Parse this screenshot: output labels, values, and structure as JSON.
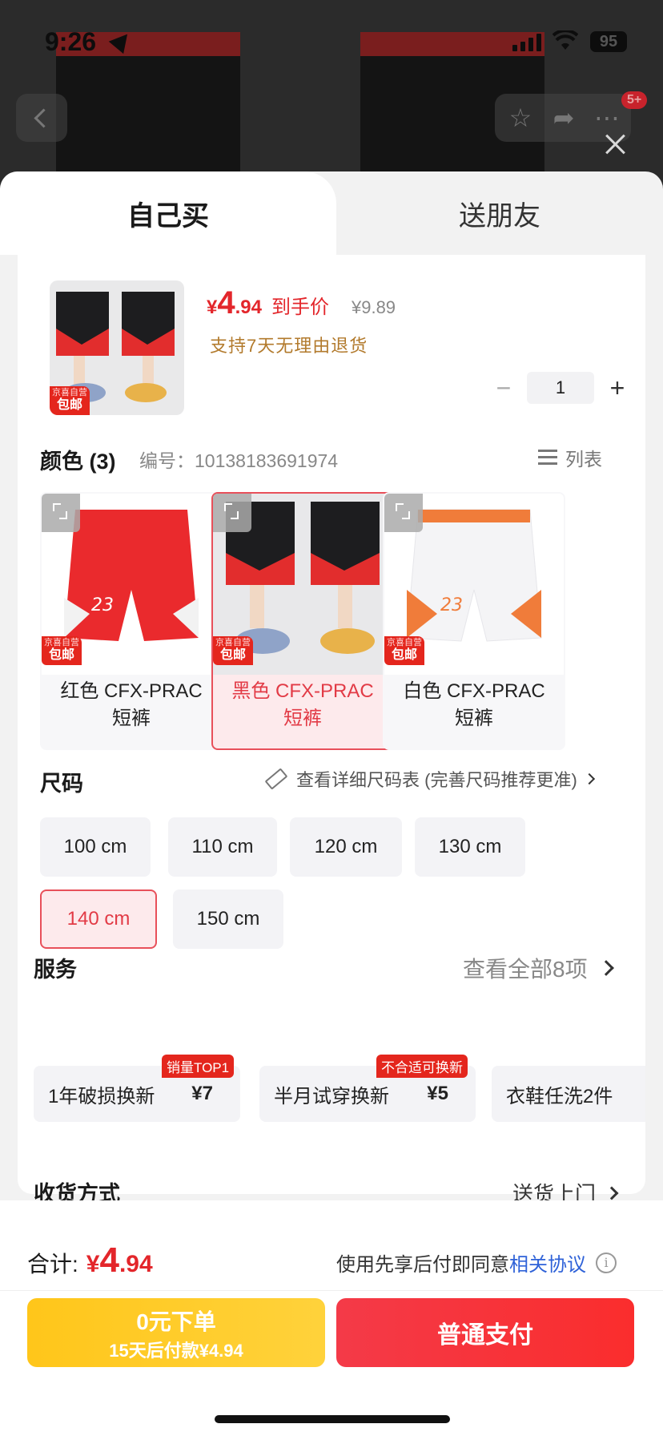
{
  "status": {
    "time": "9:26",
    "battery": "95"
  },
  "header": {
    "badge": "5+"
  },
  "tabs": [
    {
      "label": "自己买",
      "active": true
    },
    {
      "label": "送朋友",
      "active": false
    }
  ],
  "product": {
    "price_currency": "¥",
    "price_int": "4",
    "price_dec": ".94",
    "price_label": "到手价",
    "original_price": "¥9.89",
    "promise": "支持7天无理由退货",
    "thumb_tag_top": "京喜自营",
    "thumb_tag_bottom": "包邮",
    "quantity": "1"
  },
  "color_section": {
    "title": "颜色 (3)",
    "code": "编号：10138183691974",
    "list_toggle": "列表",
    "options": [
      {
        "name_line1": "红色 CFX-PRAC",
        "name_line2": "短裤",
        "selected": false,
        "tag_top": "京喜自营",
        "tag_bottom": "包邮"
      },
      {
        "name_line1": "黑色 CFX-PRAC",
        "name_line2": "短裤",
        "selected": true,
        "tag_top": "京喜自营",
        "tag_bottom": "包邮"
      },
      {
        "name_line1": "白色 CFX-PRAC",
        "name_line2": "短裤",
        "selected": false,
        "tag_top": "京喜自营",
        "tag_bottom": "包邮"
      }
    ]
  },
  "size_section": {
    "title": "尺码",
    "chart_link": "查看详细尺码表 (完善尺码推荐更准)",
    "options": [
      {
        "label": "100 cm",
        "selected": false
      },
      {
        "label": "110 cm",
        "selected": false
      },
      {
        "label": "120 cm",
        "selected": false
      },
      {
        "label": "130 cm",
        "selected": false
      },
      {
        "label": "140 cm",
        "selected": true
      },
      {
        "label": "150 cm",
        "selected": false
      }
    ]
  },
  "service_section": {
    "title": "服务",
    "view_all": "查看全部8项",
    "items": [
      {
        "name": "1年破损换新",
        "price": "¥7",
        "badge": "销量TOP1"
      },
      {
        "name": "半月试穿换新",
        "price": "¥5",
        "badge": "不合适可换新"
      },
      {
        "name": "衣鞋任洗2件",
        "price": "",
        "badge": ""
      }
    ]
  },
  "delivery_section": {
    "title": "收货方式",
    "value": "送货上门"
  },
  "footer": {
    "total_label": "合计:",
    "total_currency": "¥",
    "total_int": "4",
    "total_dec": ".94",
    "agreement_text": "使用先享后付即同意",
    "agreement_link": "相关协议",
    "pay_later_line1": "0元下单",
    "pay_later_line2": "15天后付款¥4.94",
    "pay_normal": "普通支付"
  },
  "colors": {
    "accent_red": "#e3262b",
    "pay_yellow": "#ffc61a",
    "link_blue": "#2f62d8",
    "promise_gold": "#b27a2c"
  },
  "icons": [
    "location-arrow-icon",
    "signal-icon",
    "wifi-icon",
    "battery-icon",
    "back-icon",
    "star-icon",
    "share-icon",
    "more-icon",
    "close-icon",
    "minus-icon",
    "plus-icon",
    "list-icon",
    "zoom-icon",
    "ruler-icon",
    "chevron-right-icon",
    "info-icon"
  ]
}
